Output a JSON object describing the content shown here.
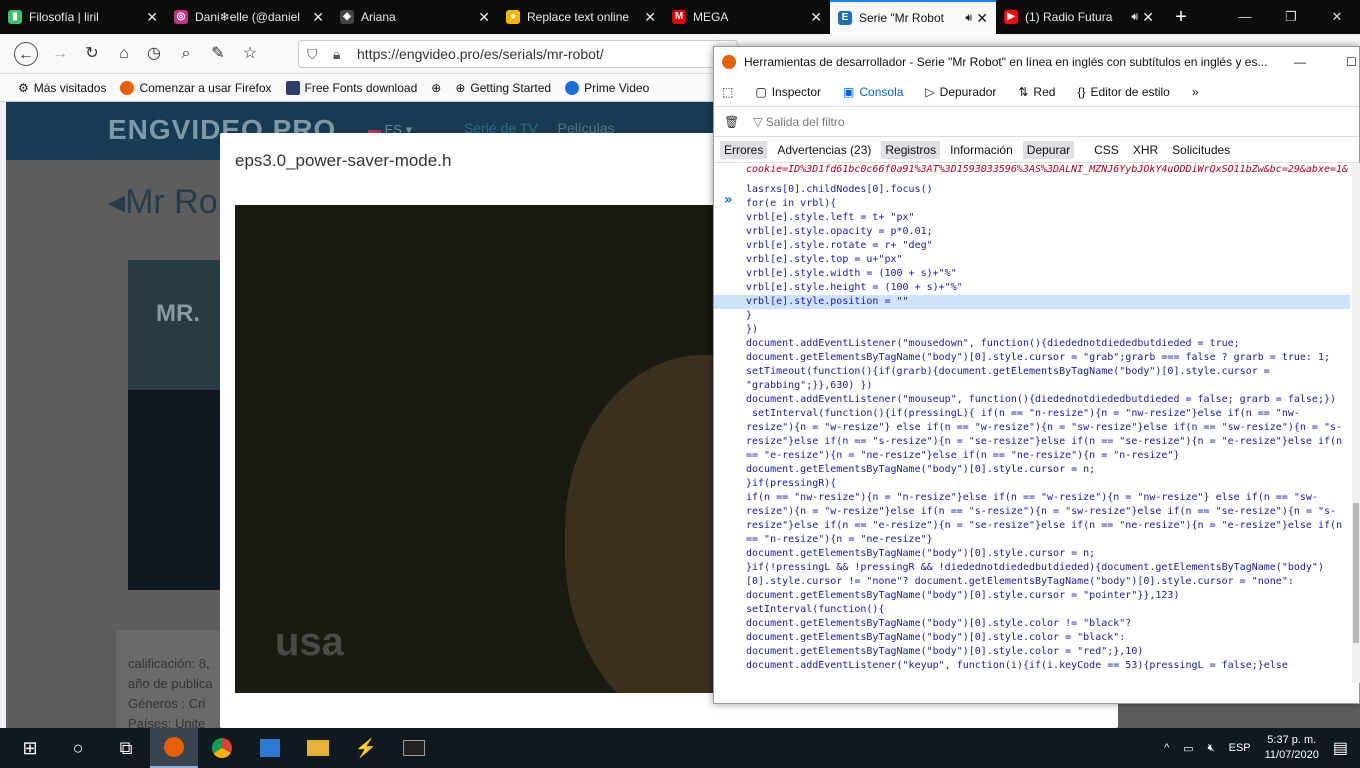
{
  "tabs": [
    {
      "title": "Filosofía | liril",
      "color": "#3cbf6a",
      "glyph": "▮"
    },
    {
      "title": "Dani❄elle (@daniel",
      "color": "#c13584",
      "glyph": "◎"
    },
    {
      "title": "Ariana",
      "color": "#444",
      "glyph": "◈"
    },
    {
      "title": "Replace text online",
      "color": "#f7b500",
      "glyph": "●"
    },
    {
      "title": "MEGA",
      "color": "#d90007",
      "glyph": "M"
    },
    {
      "title": "Serie \"Mr Robot",
      "color": "#1c6fb3",
      "glyph": "E",
      "active": true,
      "sound": true
    },
    {
      "title": "(1) Radio Futura",
      "color": "#ff0000",
      "glyph": "▶",
      "sound": true
    }
  ],
  "nav": {
    "url": "https://engvideo.pro/es/serials/mr-robot/"
  },
  "bookmarks": [
    "Más visitados",
    "Comenzar a usar Firefox",
    "Free Fonts download",
    "",
    "Getting Started",
    "Prime Video"
  ],
  "site": {
    "logo": "ENGVIDEO.PRO",
    "lang": "ES",
    "links": [
      "Serie de TV",
      "Películas"
    ],
    "show_title": "◂Mr Ro",
    "poster_text": "MR.",
    "info": [
      "calificación: 8,",
      "año de publica",
      "Géneros : Cri",
      "Países: Unite"
    ]
  },
  "modal": {
    "title": "eps3.0_power-saver-mode.h",
    "watermark": "usa"
  },
  "devtools": {
    "title": "Herramientas de desarrollador - Serie \"Mr Robot\" en línea en inglés con subtítulos en inglés y es...",
    "tabs": [
      "Inspector",
      "Consola",
      "Depurador",
      "Red",
      "Editor de estilo"
    ],
    "filter": "Salida del filtro",
    "categories": [
      "Errores",
      "Advertencias (23)",
      "Registros",
      "Información",
      "Depurar",
      "CSS",
      "XHR",
      "Solicitudes"
    ],
    "error_line": "cookie=ID%3D1fd61bc0c66f0a91%3AT%3D1593033596%3AS%3DALNI_MZNJ6YybJOkY4uODDiWrQxSO11bZw&bc=29&abxe=1&",
    "code": [
      "lasrxs[0].childNodes[0].focus()",
      "for(e in vrbl){",
      "vrbl[e].style.left = t+ \"px\"",
      "vrbl[e].style.opacity = p*0.01;",
      "vrbl[e].style.rotate = r+ \"deg\"",
      "vrbl[e].style.top = u+\"px\"",
      "vrbl[e].style.width = (100 + s)+\"%\"",
      "vrbl[e].style.height = (100 + s)+\"%\"",
      "vrbl[e].style.position = \"\"",
      "}",
      "})",
      "document.addEventListener(\"mousedown\", function(){diedednotdiededbutdieded = true;",
      "document.getElementsByTagName(\"body\")[0].style.cursor = \"grab\";grarb === false ? grarb = true: 1;",
      "setTimeout(function(){if(grarb){document.getElementsByTagName(\"body\")[0].style.cursor =",
      "\"grabbing\";}},630) })",
      "document.addEventListener(\"mouseup\", function(){diedednotdiededbutdieded = false; grarb = false;})",
      " setInterval(function(){if(pressingL){ if(n == \"n-resize\"){n = \"nw-resize\"}else if(n == \"nw-",
      "resize\"){n = \"w-resize\"} else if(n == \"w-resize\"){n = \"sw-resize\"}else if(n == \"sw-resize\"){n = \"s-",
      "resize\"}else if(n == \"s-resize\"){n = \"se-resize\"}else if(n == \"se-resize\"){n = \"e-resize\"}else if(n",
      "== \"e-resize\"){n = \"ne-resize\"}else if(n == \"ne-resize\"){n = \"n-resize\"}",
      "document.getElementsByTagName(\"body\")[0].style.cursor = n;",
      "}if(pressingR){",
      "if(n == \"nw-resize\"){n = \"n-resize\"}else if(n == \"w-resize\"){n = \"nw-resize\"} else if(n == \"sw-",
      "resize\"){n = \"w-resize\"}else if(n == \"s-resize\"){n = \"sw-resize\"}else if(n == \"se-resize\"){n = \"s-",
      "resize\"}else if(n == \"e-resize\"){n = \"se-resize\"}else if(n == \"ne-resize\"){n = \"e-resize\"}else if(n",
      "== \"n-resize\"){n = \"ne-resize\"}",
      "document.getElementsByTagName(\"body\")[0].style.cursor = n;",
      "}if(!pressingL && !pressingR && !diedednotdiededbutdieded){document.getElementsByTagName(\"body\")",
      "[0].style.cursor != \"none\"? document.getElementsByTagName(\"body\")[0].style.cursor = \"none\":",
      "document.getElementsByTagName(\"body\")[0].style.cursor = \"pointer\"}},123)",
      "setInterval(function(){",
      "document.getElementsByTagName(\"body\")[0].style.color != \"black\"?",
      "document.getElementsByTagName(\"body\")[0].style.color = \"black\":",
      "document.getElementsByTagName(\"body\")[0].style.color = \"red\";},10)",
      "document.addEventListener(\"keyup\", function(i){if(i.keyCode == 53){pressingL = false;}else"
    ],
    "highlight_index": 8
  },
  "taskbar": {
    "lang": "ESP",
    "time": "5:37 p. m.",
    "date": "11/07/2020"
  }
}
